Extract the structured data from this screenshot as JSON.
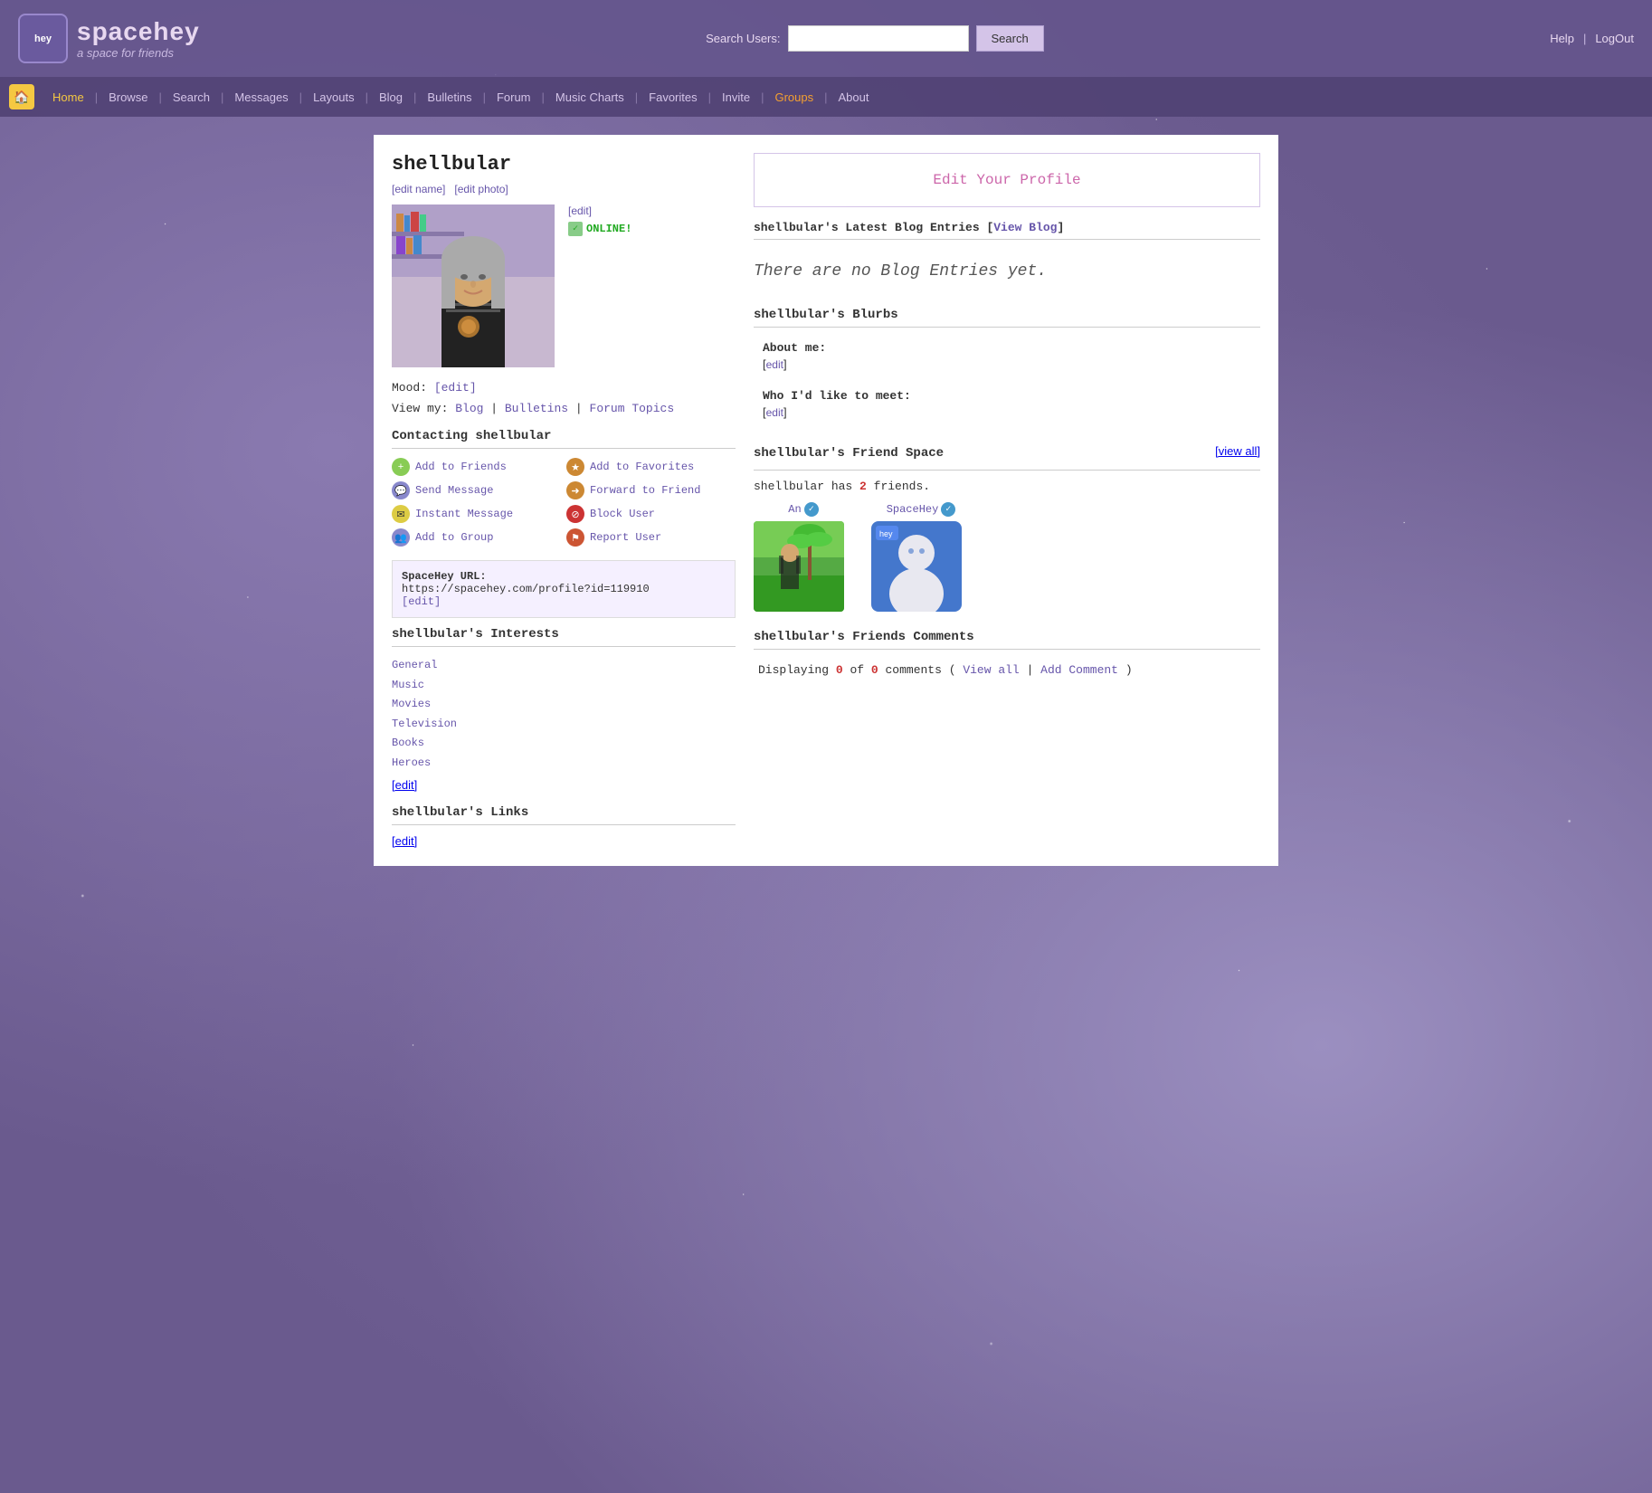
{
  "header": {
    "logo_hey": "hey",
    "logo_title": "spacehey",
    "logo_subtitle": "a space for friends",
    "search_label": "Search Users:",
    "search_placeholder": "",
    "search_button": "Search",
    "help_link": "Help",
    "logout_link": "LogOut"
  },
  "nav": {
    "items": [
      {
        "label": "Home",
        "href": "#",
        "active": true
      },
      {
        "label": "Browse",
        "href": "#"
      },
      {
        "label": "Search",
        "href": "#"
      },
      {
        "label": "Messages",
        "href": "#"
      },
      {
        "label": "Layouts",
        "href": "#"
      },
      {
        "label": "Blog",
        "href": "#"
      },
      {
        "label": "Bulletins",
        "href": "#"
      },
      {
        "label": "Forum",
        "href": "#"
      },
      {
        "label": "Music Charts",
        "href": "#"
      },
      {
        "label": "Favorites",
        "href": "#"
      },
      {
        "label": "Invite",
        "href": "#"
      },
      {
        "label": "Groups",
        "href": "#",
        "special": "orange"
      },
      {
        "label": "About",
        "href": "#"
      }
    ]
  },
  "profile": {
    "username": "shellbular",
    "edit_name_label": "[edit name]",
    "edit_photo_label": "[edit photo]",
    "edit_label": "[edit]",
    "online_status": "ONLINE!",
    "mood_label": "Mood:",
    "mood_edit": "[edit]",
    "viewmy_label": "View my:",
    "viewmy_blog": "Blog",
    "viewmy_bulletins": "Bulletins",
    "viewmy_forum": "Forum Topics",
    "contacting_header": "Contacting shellbular",
    "contacts": [
      {
        "icon": "add-friend-icon",
        "icon_class": "icon-add-friend",
        "icon_char": "+",
        "label": "Add to Friends"
      },
      {
        "icon": "add-fav-icon",
        "icon_class": "icon-fav",
        "icon_char": "★",
        "label": "Add to Favorites"
      },
      {
        "icon": "send-msg-icon",
        "icon_class": "icon-msg",
        "icon_char": "💬",
        "label": "Send Message"
      },
      {
        "icon": "forward-icon",
        "icon_class": "icon-fwd",
        "icon_char": "➜",
        "label": "Forward to Friend"
      },
      {
        "icon": "im-icon",
        "icon_class": "icon-im",
        "icon_char": "✉",
        "label": "Instant Message"
      },
      {
        "icon": "block-icon",
        "icon_class": "icon-block",
        "icon_char": "⊘",
        "label": "Block User"
      },
      {
        "icon": "group-icon",
        "icon_class": "icon-group",
        "icon_char": "👥",
        "label": "Add to Group"
      },
      {
        "icon": "report-icon",
        "icon_class": "icon-report",
        "icon_char": "⚑",
        "label": "Report User"
      }
    ],
    "url_label": "SpaceHey URL:",
    "url_value": "https://spacehey.com/profile?id=119910",
    "url_edit": "[edit]",
    "interests_header": "shellbular's Interests",
    "interests": [
      "General",
      "Music",
      "Movies",
      "Television",
      "Books",
      "Heroes"
    ],
    "interests_edit": "[edit]",
    "links_header": "shellbular's Links",
    "links_edit": "[edit]"
  },
  "right": {
    "edit_profile_link": "Edit Your Profile",
    "blog_header": "shellbular's Latest Blog Entries",
    "blog_view_label": "[View Blog]",
    "no_blog_text": "There are no Blog Entries yet.",
    "blurbs_header": "shellbular's Blurbs",
    "blurb_aboutme_title": "About me:",
    "blurb_aboutme_edit": "[edit]",
    "blurb_meet_title": "Who I'd like to meet:",
    "blurb_meet_edit": "[edit]",
    "friend_space_header": "shellbular's Friend Space",
    "friend_viewall": "[view all]",
    "friend_count_prefix": "shellbular has",
    "friend_count": "2",
    "friend_count_suffix": "friends.",
    "friends": [
      {
        "name": "An",
        "verified": true,
        "avatar_type": "an"
      },
      {
        "name": "SpaceHey",
        "verified": true,
        "avatar_type": "hey"
      }
    ],
    "comments_header": "shellbular's Friends Comments",
    "comments_display_prefix": "Displaying",
    "comments_shown": "0",
    "comments_of": "of",
    "comments_total": "0",
    "comments_suffix": "comments (",
    "comments_viewall": "View all",
    "comments_pipe": "|",
    "comments_add": "Add Comment",
    "comments_close": ")"
  }
}
